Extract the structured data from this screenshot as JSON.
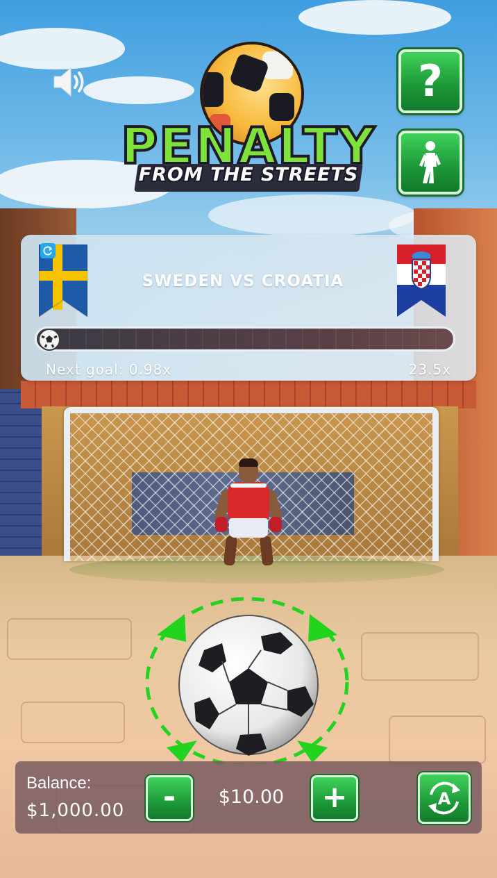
{
  "game": {
    "title": "PENALTY",
    "subtitle": "FROM THE STREETS"
  },
  "controls": {
    "sound_icon": "speaker-icon",
    "help_label": "?",
    "help_icon": "question-mark-icon",
    "player_icon": "walking-person-icon"
  },
  "match": {
    "title": "SWEDEN VS CROATIA",
    "home_flag": "sweden-flag-icon",
    "away_flag": "croatia-flag-icon",
    "refresh_icon": "refresh-icon",
    "next_goal_text": "Next goal: 0.98x",
    "max_multiplier": "23.5x",
    "progress_fraction": 0.0
  },
  "bet": {
    "balance_label": "Balance:",
    "balance_value": "$1,000.00",
    "minus_label": "-",
    "plus_label": "+",
    "bet_value": "$10.00",
    "auto_icon": "auto-play-icon"
  },
  "colors": {
    "button_green": "#1e9a3a",
    "sweden_blue": "#1f5aa8",
    "sweden_yellow": "#f7c200",
    "croatia_red": "#d8202a",
    "aim_green": "#22d41e"
  }
}
